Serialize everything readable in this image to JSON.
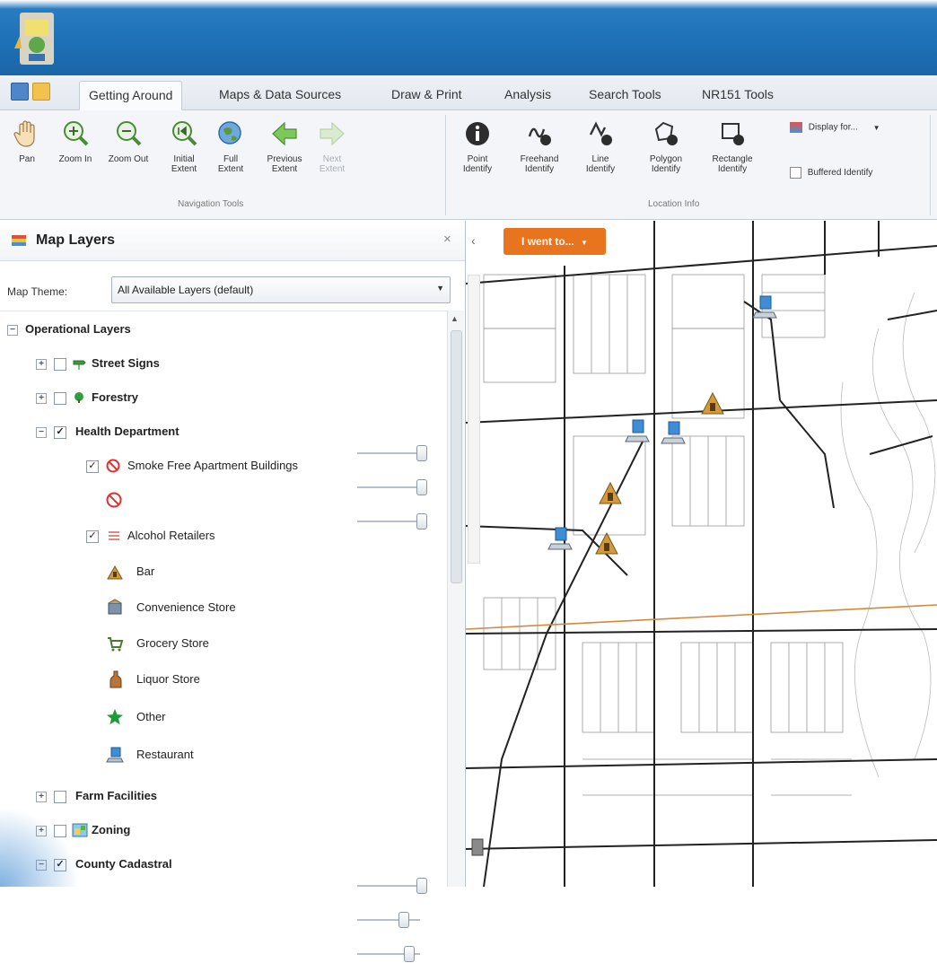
{
  "ribbon": {
    "tabs": [
      "Getting Around",
      "Maps & Data Sources",
      "Draw & Print",
      "Analysis",
      "Search Tools",
      "NR151 Tools"
    ],
    "active_tab": "Getting Around",
    "navigation_tools": [
      "Pan",
      "Zoom In",
      "Zoom Out",
      "Initial Extent",
      "Full Extent",
      "Previous Extent",
      "Next Extent"
    ],
    "navigation_group_label": "Navigation Tools",
    "location_tools": [
      "Point Identify",
      "Freehand Identify",
      "Line Identify",
      "Polygon Identify",
      "Rectangle Identify"
    ],
    "location_group_label": "Location Info",
    "display_dropdown": "Display for...",
    "buffered_identify_label": "Buffered Identify"
  },
  "panel": {
    "title": "Map Layers",
    "close_glyph": "×",
    "theme_label": "Map Theme:",
    "theme_value": "All Available Layers (default)",
    "operational_layers": "Operational Layers",
    "layers": {
      "street_signs": "Street Signs",
      "forestry": "Forestry",
      "health_department": "Health Department",
      "smoke_free": "Smoke Free Apartment Buildings",
      "alcohol_retailers": "Alcohol Retailers",
      "bar": "Bar",
      "convenience_store": "Convenience Store",
      "grocery_store": "Grocery Store",
      "liquor_store": "Liquor Store",
      "other": "Other",
      "restaurant": "Restaurant",
      "farm_facilities": "Farm Facilities",
      "zoning": "Zoning",
      "county_cadastral": "County Cadastral"
    },
    "opacity": {
      "street_signs": 1.0,
      "forestry": 1.0,
      "health_department": 1.0,
      "farm_facilities": 1.0,
      "zoning": 0.5,
      "county_cadastral": 0.6
    }
  },
  "map": {
    "went_to_button": "I went to...",
    "collapse_glyph": "‹"
  },
  "colors": {
    "accent_orange": "#e8741e",
    "header_blue": "#1e6fb5"
  }
}
